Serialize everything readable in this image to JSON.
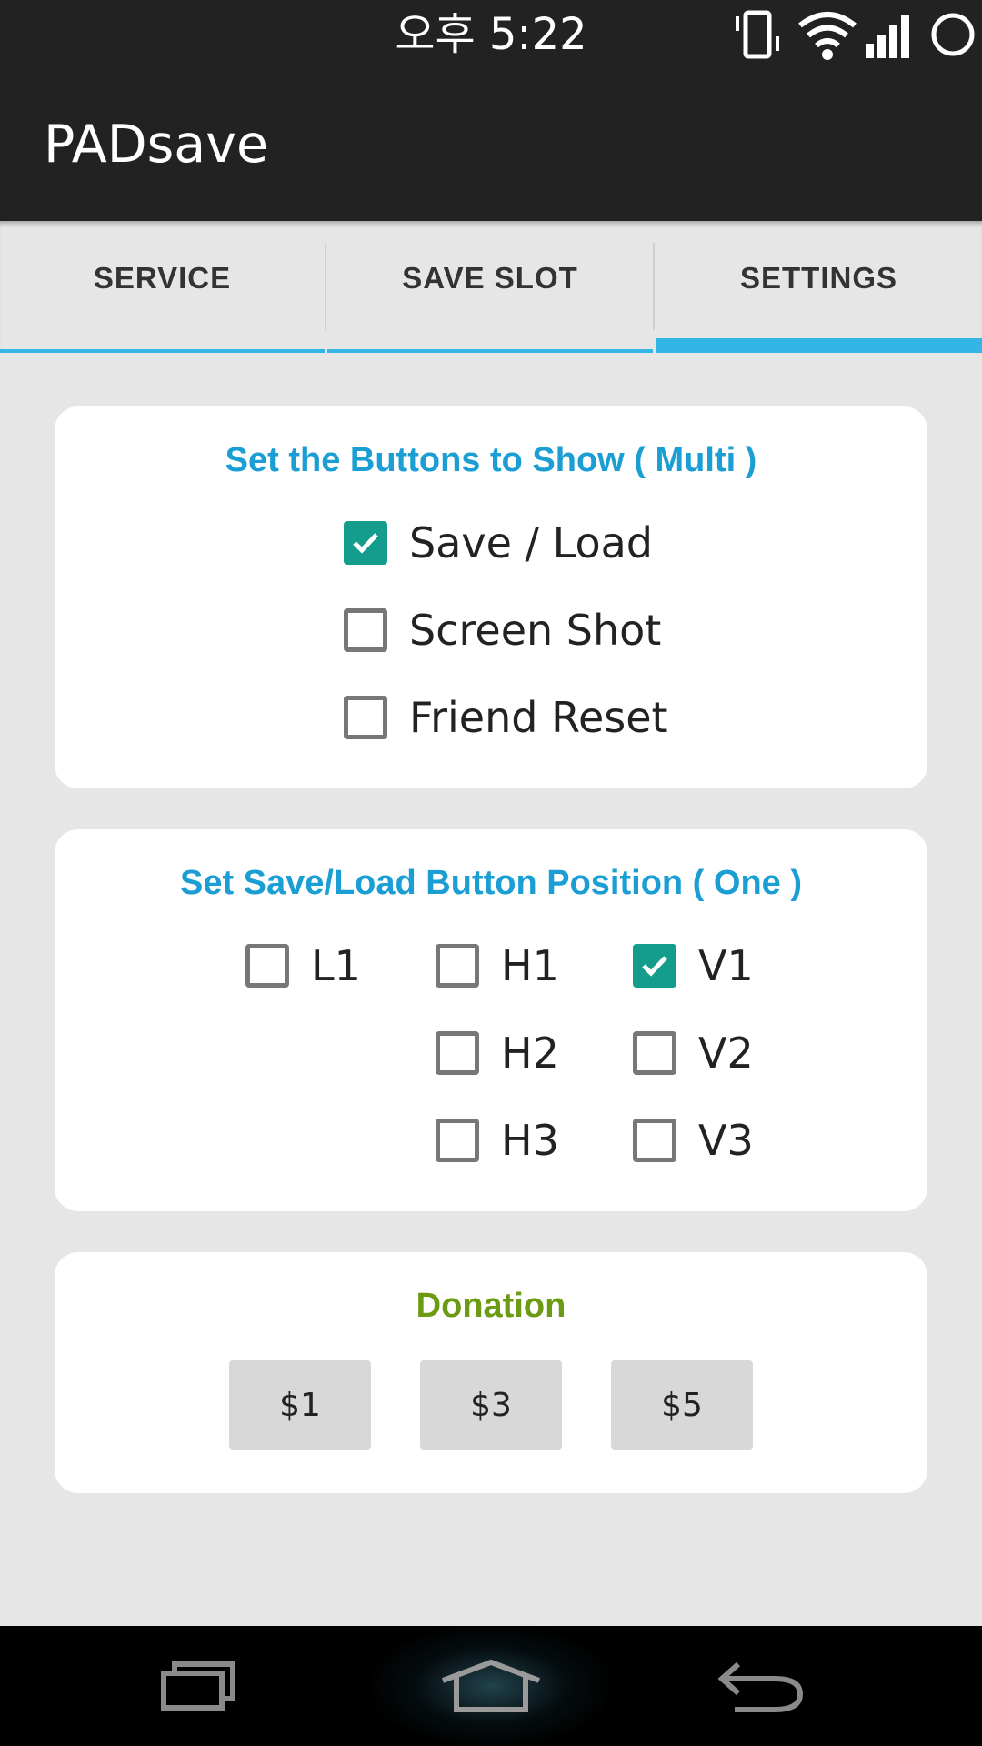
{
  "status_bar": {
    "time": "오후 5:22",
    "icons": [
      "vibrate-icon",
      "wifi-icon",
      "signal-icon",
      "circle-icon"
    ]
  },
  "action_bar": {
    "title": "PADsave"
  },
  "tabs": [
    {
      "label": "SERVICE",
      "active": false
    },
    {
      "label": "SAVE SLOT",
      "active": false
    },
    {
      "label": "SETTINGS",
      "active": true
    }
  ],
  "show_buttons": {
    "title": "Set the Buttons to Show ( Multi )",
    "options": [
      {
        "label": "Save / Load",
        "checked": true
      },
      {
        "label": "Screen Shot",
        "checked": false
      },
      {
        "label": "Friend Reset",
        "checked": false
      }
    ]
  },
  "position": {
    "title": "Set Save/Load Button Position ( One )",
    "options": [
      {
        "label": "L1",
        "checked": false
      },
      {
        "label": "H1",
        "checked": false
      },
      {
        "label": "V1",
        "checked": true
      },
      {
        "label": "H2",
        "checked": false
      },
      {
        "label": "V2",
        "checked": false
      },
      {
        "label": "H3",
        "checked": false
      },
      {
        "label": "V3",
        "checked": false
      }
    ]
  },
  "donation": {
    "title": "Donation",
    "buttons": [
      "$1",
      "$3",
      "$5"
    ]
  },
  "nav_bar": {
    "icons": [
      "recent-apps-icon",
      "home-icon",
      "back-icon"
    ]
  },
  "colors": {
    "accent_blue": "#1a9ed3",
    "tab_indicator": "#33b5e5",
    "checkbox_checked": "#149c8c",
    "donation_green": "#6c9a13"
  }
}
